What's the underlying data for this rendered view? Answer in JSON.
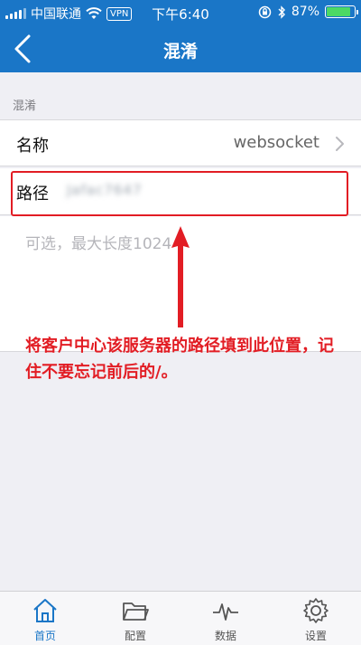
{
  "status_bar": {
    "carrier": "中国联通",
    "vpn": "VPN",
    "time": "下午6:40",
    "battery_percent": "87%",
    "battery_level": 0.87,
    "icons": [
      "signal-icon",
      "wifi-icon",
      "lock-rotation-icon",
      "bluetooth-icon",
      "battery-icon"
    ]
  },
  "nav": {
    "title": "混淆",
    "back_icon": "chevron-left-icon"
  },
  "section": {
    "label": "混淆"
  },
  "rows": {
    "name": {
      "label": "名称",
      "value": "websocket",
      "chevron_icon": "chevron-right-icon"
    },
    "path": {
      "label": "路径",
      "value": "Jafac7647"
    }
  },
  "hint": "可选，最大长度1024",
  "annotation": "将客户中心该服务器的路径填到此位置，记住不要忘记前后的/。",
  "tabbar": {
    "items": [
      {
        "label": "首页",
        "icon": "home-icon",
        "active": true
      },
      {
        "label": "配置",
        "icon": "folder-icon",
        "active": false
      },
      {
        "label": "数据",
        "icon": "pulse-icon",
        "active": false
      },
      {
        "label": "设置",
        "icon": "gear-icon",
        "active": false
      }
    ]
  },
  "colors": {
    "primary": "#1a76c7",
    "annotation_red": "#e21d24",
    "battery_green": "#4cd964"
  }
}
